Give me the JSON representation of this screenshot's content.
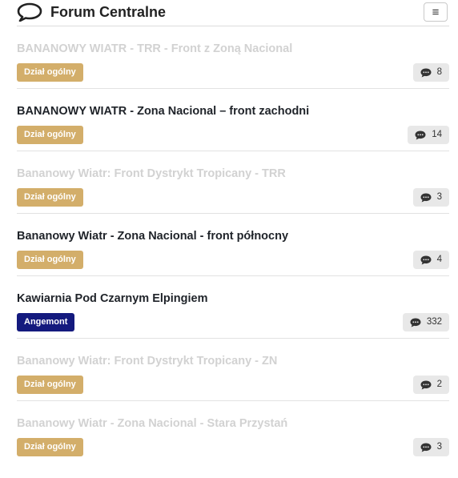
{
  "header": {
    "title": "Forum Centralne",
    "logo_icon": "speech-bubble-icon",
    "menu_icon": "hamburger-menu-icon",
    "menu_glyph": "≡"
  },
  "colors": {
    "category_general": "#d3ae6a",
    "category_angemont": "#141a7e",
    "faded_title": "#d2d2d2"
  },
  "topics": [
    {
      "title": "BANANOWY WIATR - TRR - Front z Zoną Nacional",
      "category": "Dział ogólny",
      "replies": "8",
      "faded": true
    },
    {
      "title": "BANANOWY WIATR - Zona Nacional – front zachodni",
      "category": "Dział ogólny",
      "replies": "14",
      "faded": false
    },
    {
      "title": "Bananowy Wiatr: Front Dystrykt Tropicany - TRR",
      "category": "Dział ogólny",
      "replies": "3",
      "faded": true
    },
    {
      "title": "Bananowy Wiatr - Zona Nacional - front północny",
      "category": "Dział ogólny",
      "replies": "4",
      "faded": false
    },
    {
      "title": "Kawiarnia Pod Czarnym Elpingiem",
      "category": "Angemont",
      "replies": "332",
      "faded": false
    },
    {
      "title": "Bananowy Wiatr: Front Dystrykt Tropicany - ZN",
      "category": "Dział ogólny",
      "replies": "2",
      "faded": true
    },
    {
      "title": "Bananowy Wiatr - Zona Nacional - Stara Przystań",
      "category": "Dział ogólny",
      "replies": "3",
      "faded": true
    }
  ]
}
